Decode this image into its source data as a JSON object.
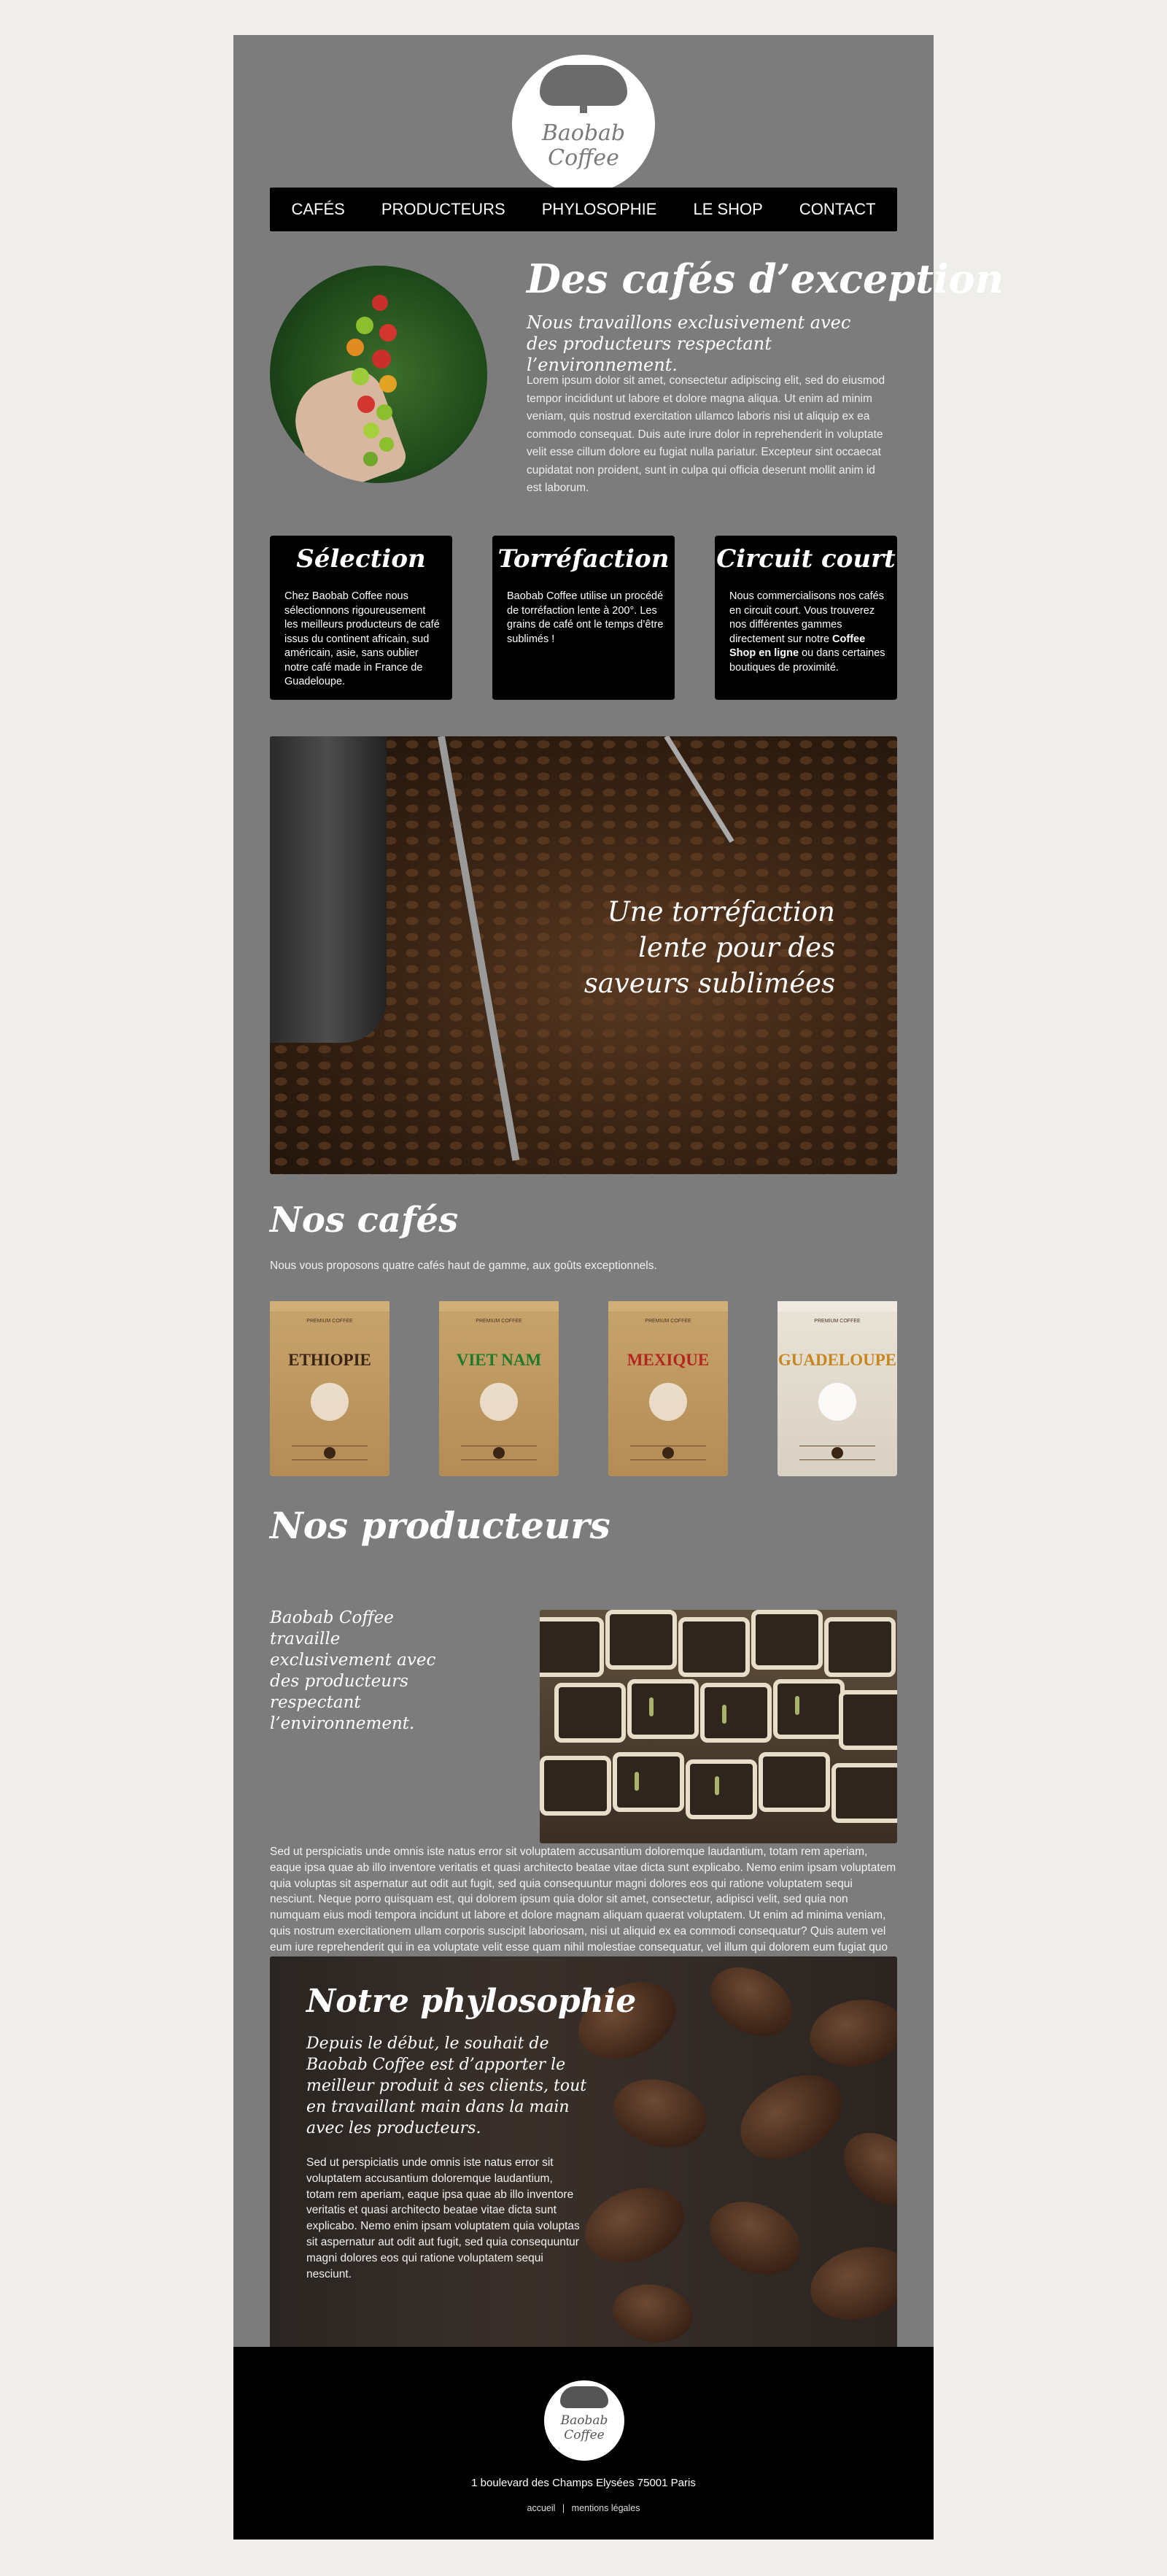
{
  "brand": {
    "line1": "Baobab",
    "line2": "Coffee"
  },
  "nav": {
    "items": [
      "CAFÉS",
      "PRODUCTEURS",
      "PHYLOSOPHIE",
      "LE SHOP",
      "CONTACT"
    ]
  },
  "intro": {
    "title": "Des cafés d’exception",
    "subtitle": "Nous travaillons exclusivement avec des producteurs respectant l’environnement.",
    "body": "Lorem ipsum dolor sit amet, consectetur adipiscing elit, sed do eiusmod tempor incididunt ut labore et dolore magna aliqua. Ut enim ad minim veniam, quis nostrud exercitation ullamco laboris nisi ut aliquip ex ea commodo consequat. Duis aute irure dolor in reprehenderit in voluptate velit esse cillum dolore eu fugiat nulla pariatur. Excepteur sint occaecat cupidatat non proident, sunt in culpa qui officia deserunt mollit anim id est laborum."
  },
  "cards": [
    {
      "title": "Sélection",
      "text": "Chez Baobab Coffee nous sélectionnons rigoureusement les meilleurs producteurs de café issus du continent africain, sud américain, asie, sans oublier notre café made in France de Guadeloupe."
    },
    {
      "title": "Torréfaction",
      "text": "Baobab Coffee utilise un procédé de torréfaction lente à 200°. Les grains de café ont le temps d’être sublimés !"
    },
    {
      "title": "Circuit court",
      "text_before": "Nous commercialisons nos cafés en circuit court. Vous trouverez nos différentes gammes directement sur notre ",
      "text_strong": "Coffee Shop en ligne",
      "text_after": " ou dans certaines boutiques de proximité."
    }
  ],
  "roast": {
    "caption_line1": "Une torréfaction",
    "caption_line2": "lente pour des",
    "caption_line3": "saveurs sublimées"
  },
  "cafes": {
    "title": "Nos cafés",
    "intro": "Nous vous proposons quatre cafés haut de gamme, aux goûts exceptionnels.",
    "bag_brand": "PREMIUM COFFEE",
    "products": [
      {
        "name": "ETHIOPIE",
        "color": "#3a2414"
      },
      {
        "name": "VIET NAM",
        "color": "#1f7a2a"
      },
      {
        "name": "MEXIQUE",
        "color": "#b3261e"
      },
      {
        "name": "GUADELOUPE",
        "color": "#c8861e"
      }
    ]
  },
  "producteurs": {
    "title": "Nos producteurs",
    "subtitle": "Baobab Coffee travaille exclusivement avec des producteurs respectant l’environnement.",
    "body": "Sed ut perspiciatis unde omnis iste natus error sit voluptatem accusantium doloremque laudantium, totam rem aperiam, eaque ipsa quae ab illo inventore veritatis et quasi architecto beatae vitae dicta sunt explicabo. Nemo enim ipsam voluptatem quia voluptas sit aspernatur aut odit aut fugit, sed quia consequuntur magni dolores eos qui ratione voluptatem sequi nesciunt. Neque porro quisquam est, qui dolorem ipsum quia dolor sit amet, consectetur, adipisci velit, sed quia non numquam eius modi tempora incidunt ut labore et dolore magnam aliquam quaerat voluptatem. Ut enim ad minima veniam, quis nostrum exercitationem ullam corporis suscipit laboriosam, nisi ut aliquid ex ea commodi consequatur? Quis autem vel eum iure reprehenderit qui in ea voluptate velit esse quam nihil molestiae consequatur, vel illum qui dolorem eum fugiat quo voluptas nulla pariatur?"
  },
  "philosophie": {
    "title": "Notre phylosophie",
    "subtitle": "Depuis le début, le souhait de Baobab Coffee est d’apporter le meilleur produit à ses clients, tout en travaillant main dans la main avec les producteurs.",
    "body": "Sed ut perspiciatis unde omnis iste natus error sit voluptatem accusantium doloremque laudantium, totam rem aperiam, eaque ipsa quae ab illo inventore veritatis et quasi architecto beatae vitae dicta sunt explicabo. Nemo enim ipsam voluptatem quia voluptas sit aspernatur aut odit aut fugit, sed quia consequuntur magni dolores eos qui ratione voluptatem sequi nesciunt."
  },
  "footer": {
    "address": "1 boulevard des Champs Elysées 75001 Paris",
    "link_home": "accueil",
    "separator": "|",
    "link_legal": "mentions légales"
  }
}
